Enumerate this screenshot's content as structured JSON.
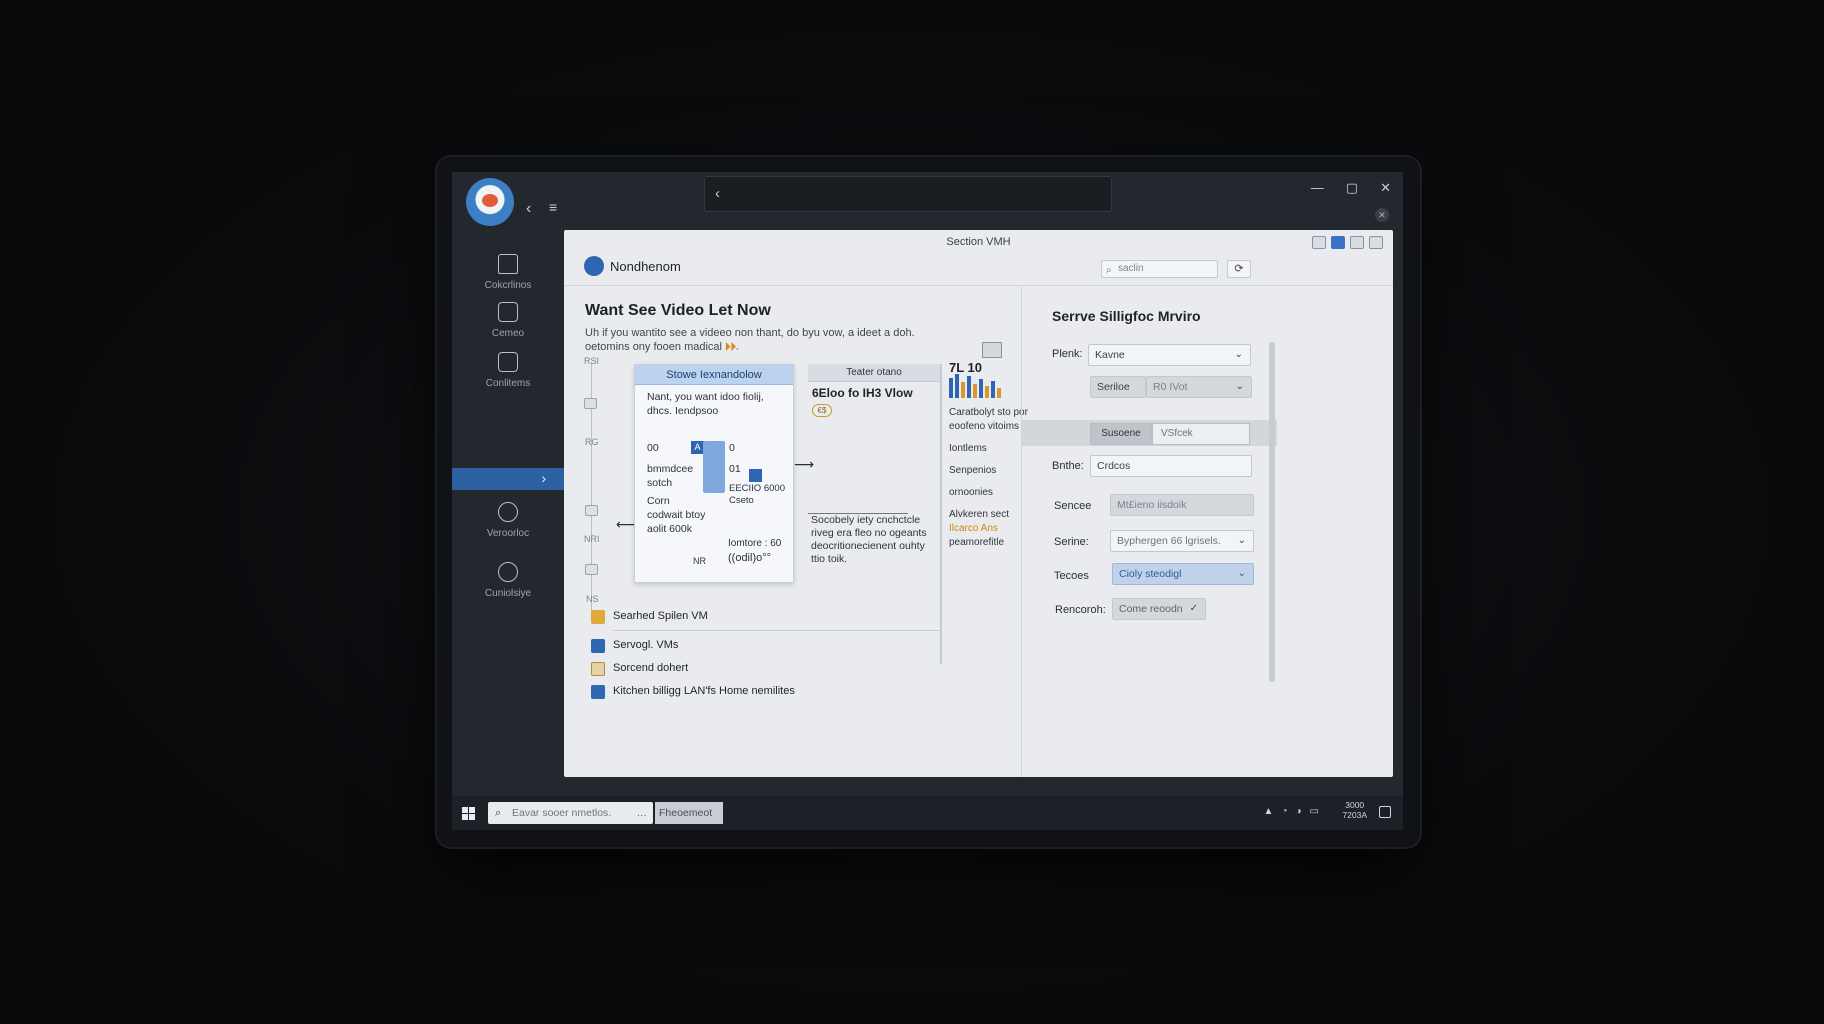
{
  "window": {
    "back_glyph": "‹",
    "menu_glyph": "≡",
    "controls": {
      "minimize": "—",
      "maximize": "▢",
      "close": "✕"
    }
  },
  "nav": {
    "items": [
      {
        "label": "Cokcrlinos",
        "icon": "home-icon"
      },
      {
        "label": "Cemeo",
        "icon": "square-icon"
      },
      {
        "label": "Conlitems",
        "icon": "download-icon"
      },
      {
        "label": "Veroorloc",
        "icon": "search-icon"
      },
      {
        "label": "Cuniolsiye",
        "icon": "refresh-icon"
      }
    ],
    "active_chevron": "›"
  },
  "panel": {
    "title": "Section VMH",
    "brand": "Nondhenom",
    "search_placeholder": "saclin",
    "content_title": "Want See Video Let Now",
    "content_desc": "Uh if you wantito see a videeo non thant, do byu vow, a ideet a doh. oetomins ony fooen madical",
    "content_desc_accent": "⏵⏵.",
    "card": {
      "header": "Stowe Iexnandolow",
      "intro": "Nant, you want idoo fiolij, dhcs. Iendpsoo",
      "val_00": "00",
      "val_0": "0",
      "val_01": "01",
      "badge_a": "A",
      "line_b1": "bmmdcee",
      "line_b2": "sotch",
      "code": "EECIIO 6000",
      "code2": "Cseto",
      "line_c1": "Corn",
      "line_c2": "codwait btoy",
      "line_c3": "aolit 600k",
      "foot_a": "Iomtore : 60",
      "foot_b": "((odil)o°°",
      "foot_c": "NR"
    },
    "pane2": {
      "header": "Teater otano",
      "title": "6Eloo fo IH3 Vlow",
      "coin": "€$",
      "note": "Socobely iety cnchctcle riveg era fleo no ogeants deocritionecienent ouhty ttio toik."
    },
    "mini_chart": {
      "label": "7L 10"
    },
    "side_list": [
      "Caratbolyt sto por eoofeno vitoims",
      "Iontlems",
      "Senpenios",
      "ornoonies",
      "Alvkeren sect",
      "Ilcarco Ans",
      "peamorefitle"
    ],
    "side_labels": [
      "RSI",
      "RG",
      "NRI",
      "NS"
    ],
    "files": [
      {
        "label": "Searhed Spilen VM",
        "icon": "folder-icon",
        "color": "#e1a93a"
      },
      {
        "label": "Servogl. VMs",
        "icon": "shield-icon",
        "color": "#2f66b3"
      },
      {
        "label": "Sorcend dohert",
        "icon": "document-icon",
        "color": "#b98a3e"
      },
      {
        "label": "Kitchen billigg LAN'fs Home nemilites",
        "icon": "window-icon",
        "color": "#2f66b3"
      }
    ]
  },
  "settings": {
    "title": "Serrve Silligfoc Mrviro",
    "fields": [
      {
        "label": "Plenk:",
        "value": "Kavne"
      },
      {
        "label": "Seriloe",
        "value": "R0 IVot"
      },
      {
        "label": "Bnthe:",
        "value": "Crdcos"
      },
      {
        "label": "Sencee",
        "value": "Mt£ieno iisdoik"
      },
      {
        "label": "Serine:",
        "value": "Byphergen 66 lgrisels."
      },
      {
        "label": "Tecoes",
        "value": "Cioly steodigl"
      },
      {
        "label": "Rencoroh:",
        "value": "Come reoodn"
      }
    ],
    "segments": [
      "Susoene",
      "VSfcek"
    ]
  },
  "taskbar": {
    "search_placeholder": "Eavar sooer nmetlos.",
    "more": "…",
    "pill": "Fheoemeot",
    "clock_time": "3000",
    "clock_date": "7203A"
  },
  "colors": {
    "accent": "#2f66b3",
    "desktop": "#0b0c0e",
    "window_dark": "#23272e"
  }
}
